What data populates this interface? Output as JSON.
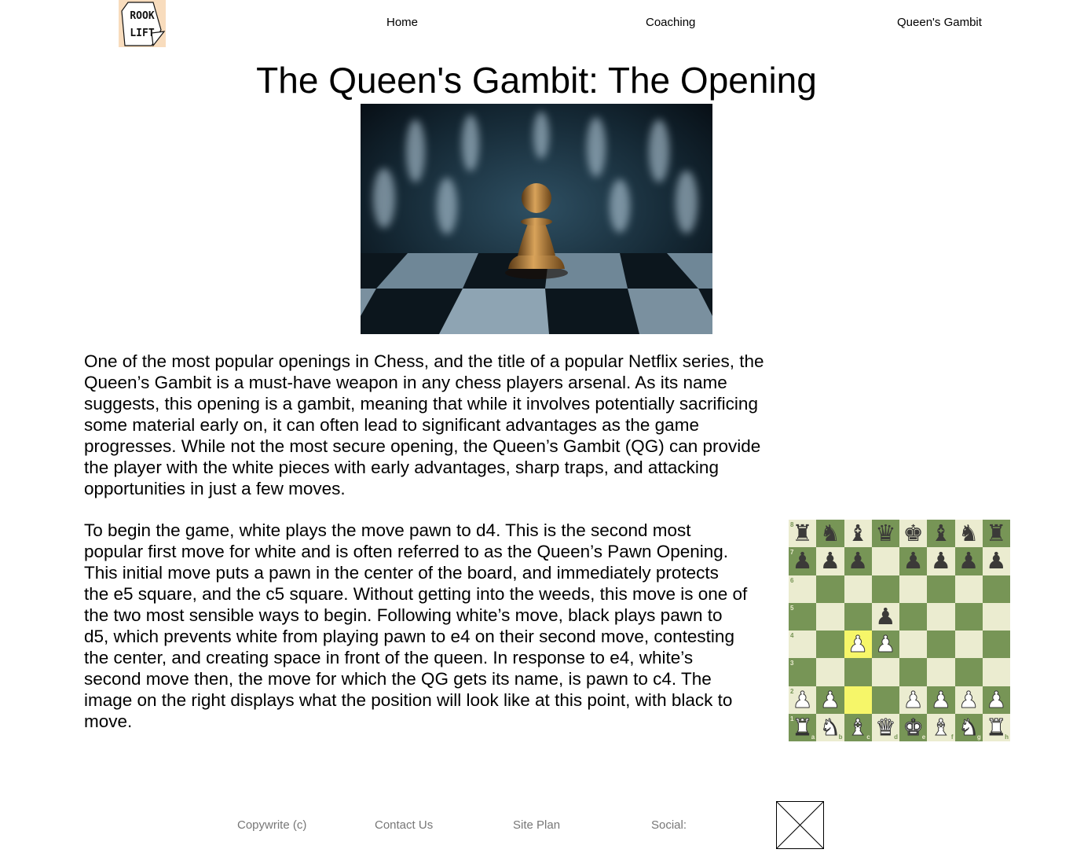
{
  "logo": {
    "line1": "ROOK",
    "line2": "LIFT"
  },
  "nav": {
    "home": "Home",
    "coaching": "Coaching",
    "queens_gambit": "Queen's Gambit"
  },
  "page_title": "The Queen's Gambit: The Opening",
  "hero_image": {
    "alt": "chess-pawn-photo"
  },
  "paragraphs": [
    "One of the most popular openings in Chess, and the title of a popular Netflix series, the Queen’s Gambit is a must-have weapon in any chess players arsenal. As its name suggests, this opening is a gambit, meaning that while it involves potentially sacrificing some material early on, it can often lead to significant advantages as the game progresses. While not the most secure opening, the Queen’s Gambit (QG) can provide the player with the white pieces with early advantages, sharp traps, and attacking opportunities in just a few moves.",
    "To begin the game, white plays the move pawn to d4. This is the second most popular first move for white and is often referred to as the Queen’s Pawn Opening. This initial move puts a pawn in the center of the board, and immediately protects the e5 square, and the c5 square. Without getting into the weeds, this move is one of the two most sensible ways to begin. Following white’s move, black plays pawn to d5, which prevents white from playing pawn to e4 on their second move, contesting the center, and creating space in front of the queen. In response to e4, white’s second move then, the move for which the QG gets its name, is pawn to c4. The image on the right displays what the position will look like at this point, with black to move."
  ],
  "board": {
    "rows": [
      [
        "r",
        "n",
        "b",
        "q",
        "k",
        "b",
        "n",
        "r"
      ],
      [
        "p",
        "p",
        "p",
        "",
        "p",
        "p",
        "p",
        "p"
      ],
      [
        "",
        "",
        "",
        "",
        "",
        "",
        "",
        ""
      ],
      [
        "",
        "",
        "",
        "p",
        "",
        "",
        "",
        ""
      ],
      [
        "",
        "",
        "P",
        "P",
        "",
        "",
        "",
        ""
      ],
      [
        "",
        "",
        "",
        "",
        "",
        "",
        "",
        ""
      ],
      [
        "P",
        "P",
        "",
        "",
        "P",
        "P",
        "P",
        "P"
      ],
      [
        "R",
        "N",
        "B",
        "Q",
        "K",
        "B",
        "N",
        "R"
      ]
    ],
    "highlight": [
      "c4",
      "c2"
    ],
    "ranks": [
      "8",
      "7",
      "6",
      "5",
      "4",
      "3",
      "2",
      "1"
    ],
    "files": [
      "a",
      "b",
      "c",
      "d",
      "e",
      "f",
      "g",
      "h"
    ],
    "light_color": "#ebecd0",
    "dark_color": "#779556",
    "highlight_color": "#f6f669"
  },
  "footer": {
    "copyright": "Copywrite (c)",
    "contact": "Contact Us",
    "site_plan": "Site Plan",
    "social": "Social:"
  },
  "social_icon": "image-placeholder-icon"
}
